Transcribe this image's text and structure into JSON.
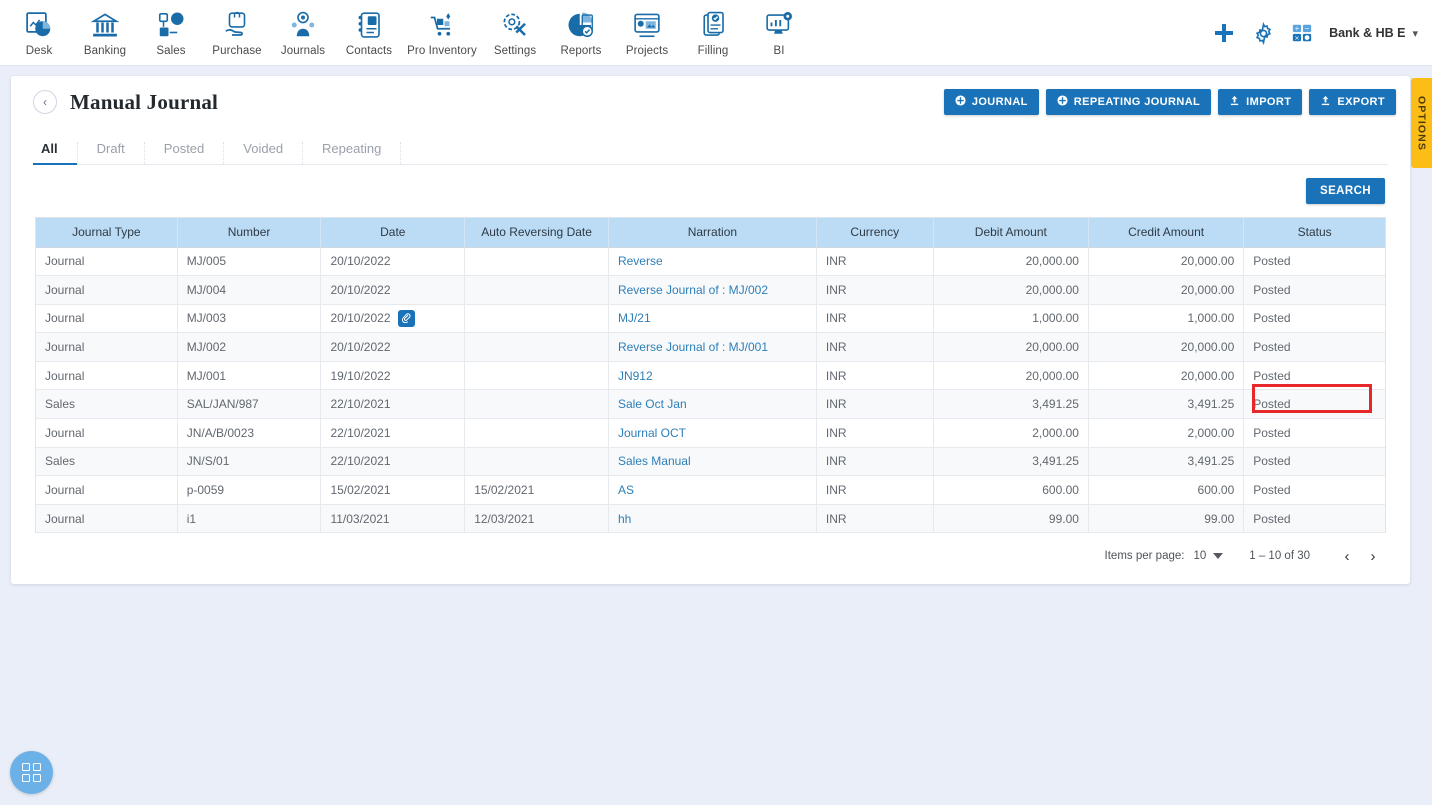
{
  "topnav": {
    "items": [
      {
        "label": "Desk",
        "icon": "dashboard-icon"
      },
      {
        "label": "Banking",
        "icon": "bank-icon"
      },
      {
        "label": "Sales",
        "icon": "sales-icon"
      },
      {
        "label": "Purchase",
        "icon": "purchase-icon"
      },
      {
        "label": "Journals",
        "icon": "journals-icon"
      },
      {
        "label": "Contacts",
        "icon": "contacts-icon"
      },
      {
        "label": "Pro Inventory",
        "icon": "inventory-icon"
      },
      {
        "label": "Settings",
        "icon": "settings-icon"
      },
      {
        "label": "Reports",
        "icon": "reports-icon"
      },
      {
        "label": "Projects",
        "icon": "projects-icon"
      },
      {
        "label": "Filling",
        "icon": "filling-icon"
      },
      {
        "label": "BI",
        "icon": "bi-icon"
      }
    ],
    "add_icon": "plus-icon",
    "settings_icon": "gear-icon",
    "calculator_icon": "calculator-icon",
    "user": "Bank & HB E",
    "user_caret": "chevron-down-icon"
  },
  "header": {
    "back_icon": "chevron-left-icon",
    "title": "Manual Journal",
    "actions": [
      {
        "label": "JOURNAL",
        "icon": "plus-circle-icon"
      },
      {
        "label": "REPEATING JOURNAL",
        "icon": "plus-circle-icon"
      },
      {
        "label": "IMPORT",
        "icon": "upload-icon"
      },
      {
        "label": "EXPORT",
        "icon": "upload-icon"
      }
    ]
  },
  "tabs": [
    {
      "label": "All",
      "active": true
    },
    {
      "label": "Draft",
      "active": false
    },
    {
      "label": "Posted",
      "active": false
    },
    {
      "label": "Voided",
      "active": false
    },
    {
      "label": "Repeating",
      "active": false
    }
  ],
  "search": {
    "label": "SEARCH"
  },
  "table": {
    "columns": [
      "Journal Type",
      "Number",
      "Date",
      "Auto Reversing Date",
      "Narration",
      "Currency",
      "Debit Amount",
      "Credit Amount",
      "Status"
    ],
    "rows": [
      {
        "type": "Journal",
        "number": "MJ/005",
        "date": "20/10/2022",
        "clip": false,
        "auto_rev": "",
        "narration": "Reverse",
        "currency": "INR",
        "debit": "20,000.00",
        "credit": "20,000.00",
        "status": "Posted"
      },
      {
        "type": "Journal",
        "number": "MJ/004",
        "date": "20/10/2022",
        "clip": false,
        "auto_rev": "",
        "narration": "Reverse Journal of : MJ/002",
        "currency": "INR",
        "debit": "20,000.00",
        "credit": "20,000.00",
        "status": "Posted"
      },
      {
        "type": "Journal",
        "number": "MJ/003",
        "date": "20/10/2022",
        "clip": true,
        "auto_rev": "",
        "narration": "MJ/21",
        "currency": "INR",
        "debit": "1,000.00",
        "credit": "1,000.00",
        "status": "Posted"
      },
      {
        "type": "Journal",
        "number": "MJ/002",
        "date": "20/10/2022",
        "clip": false,
        "auto_rev": "",
        "narration": "Reverse Journal of : MJ/001",
        "currency": "INR",
        "debit": "20,000.00",
        "credit": "20,000.00",
        "status": "Posted"
      },
      {
        "type": "Journal",
        "number": "MJ/001",
        "date": "19/10/2022",
        "clip": false,
        "auto_rev": "",
        "narration": "JN912",
        "currency": "INR",
        "debit": "20,000.00",
        "credit": "20,000.00",
        "status": "Posted"
      },
      {
        "type": "Sales",
        "number": "SAL/JAN/987",
        "date": "22/10/2021",
        "clip": false,
        "auto_rev": "",
        "narration": "Sale Oct Jan",
        "currency": "INR",
        "debit": "3,491.25",
        "credit": "3,491.25",
        "status": "Posted",
        "highlighted": true
      },
      {
        "type": "Journal",
        "number": "JN/A/B/0023",
        "date": "22/10/2021",
        "clip": false,
        "auto_rev": "",
        "narration": "Journal OCT",
        "currency": "INR",
        "debit": "2,000.00",
        "credit": "2,000.00",
        "status": "Posted"
      },
      {
        "type": "Sales",
        "number": "JN/S/01",
        "date": "22/10/2021",
        "clip": false,
        "auto_rev": "",
        "narration": "Sales Manual",
        "currency": "INR",
        "debit": "3,491.25",
        "credit": "3,491.25",
        "status": "Posted"
      },
      {
        "type": "Journal",
        "number": "p-0059",
        "date": "15/02/2021",
        "clip": false,
        "auto_rev": "15/02/2021",
        "narration": "AS",
        "currency": "INR",
        "debit": "600.00",
        "credit": "600.00",
        "status": "Posted"
      },
      {
        "type": "Journal",
        "number": "i1",
        "date": "11/03/2021",
        "clip": false,
        "auto_rev": "12/03/2021",
        "narration": "hh",
        "currency": "INR",
        "debit": "99.00",
        "credit": "99.00",
        "status": "Posted"
      }
    ]
  },
  "paginator": {
    "items_label": "Items per page:",
    "items_value": "10",
    "range": "1 – 10 of 30",
    "prev_icon": "chevron-left-icon",
    "next_icon": "chevron-right-icon"
  },
  "options_tab": {
    "label": "OPTIONS"
  },
  "fab": {
    "icon": "grid-apps-icon"
  },
  "colors": {
    "accent": "#1a73b8",
    "table_header": "#bcdcf5",
    "page_bg": "#e9eef8",
    "highlight": "#e8272b",
    "options_bg": "#fbbd16",
    "link": "#2d7fb8"
  }
}
